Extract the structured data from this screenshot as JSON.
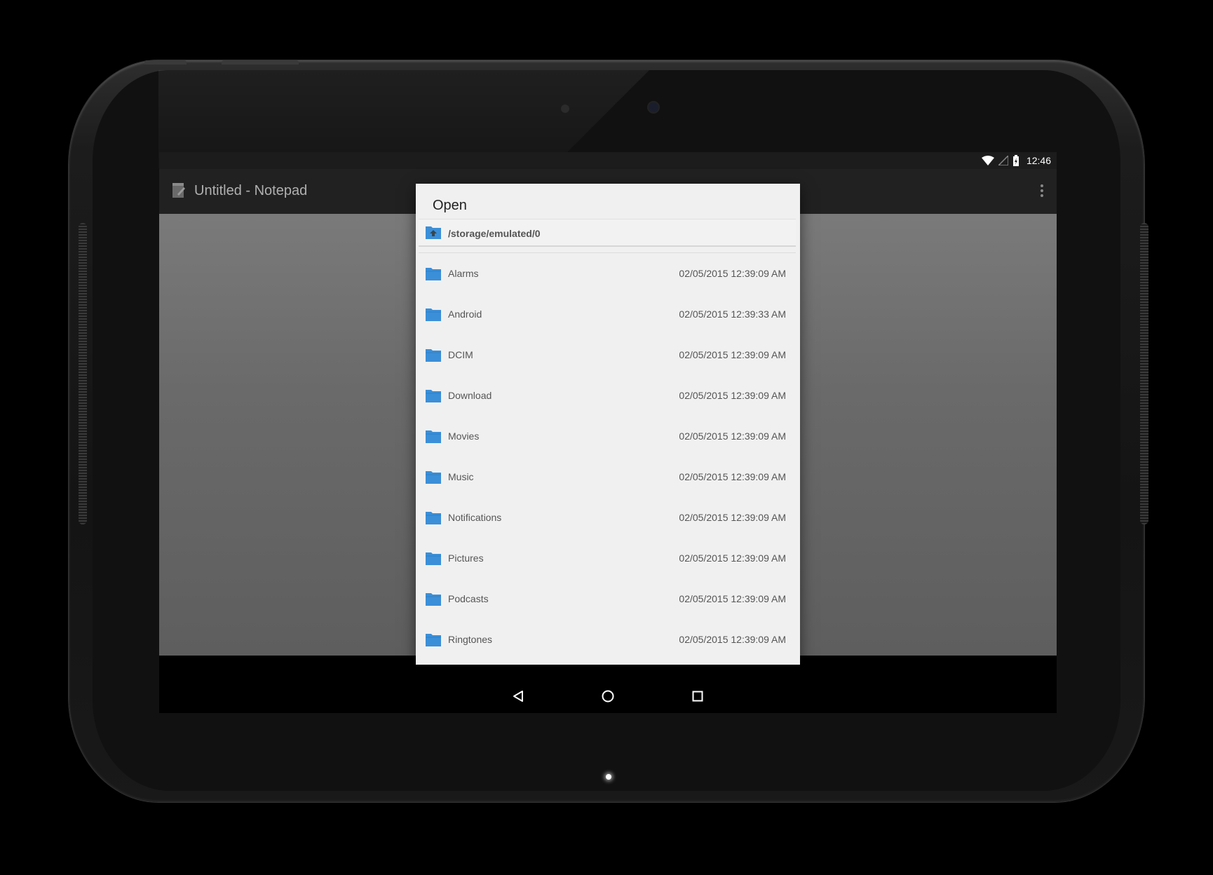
{
  "status": {
    "time": "12:46"
  },
  "app": {
    "title": "Untitled - Notepad"
  },
  "dialog": {
    "title": "Open",
    "path": "/storage/emulated/0",
    "items": [
      {
        "name": "Alarms",
        "date": "02/05/2015 12:39:09 AM"
      },
      {
        "name": "Android",
        "date": "02/05/2015 12:39:33 AM"
      },
      {
        "name": "DCIM",
        "date": "02/05/2015 12:39:09 AM"
      },
      {
        "name": "Download",
        "date": "02/05/2015 12:39:09 AM"
      },
      {
        "name": "Movies",
        "date": "02/05/2015 12:39:09 AM"
      },
      {
        "name": "Music",
        "date": "02/05/2015 12:39:09 AM"
      },
      {
        "name": "Notifications",
        "date": "02/05/2015 12:39:09 AM"
      },
      {
        "name": "Pictures",
        "date": "02/05/2015 12:39:09 AM"
      },
      {
        "name": "Podcasts",
        "date": "02/05/2015 12:39:09 AM"
      },
      {
        "name": "Ringtones",
        "date": "02/05/2015 12:39:09 AM"
      }
    ]
  },
  "icons": {
    "folder": "folder-icon",
    "parent": "folder-up-icon",
    "app": "notepad-icon",
    "overflow": "overflow-menu-icon",
    "back": "back-icon",
    "home": "home-icon",
    "recents": "recents-icon",
    "wifi": "wifi-icon",
    "signal": "signal-icon",
    "battery": "battery-charging-icon"
  },
  "colors": {
    "folder": "#3b8fd8",
    "dialog_bg": "#f0f0f0",
    "actionbar_bg": "#212121"
  }
}
